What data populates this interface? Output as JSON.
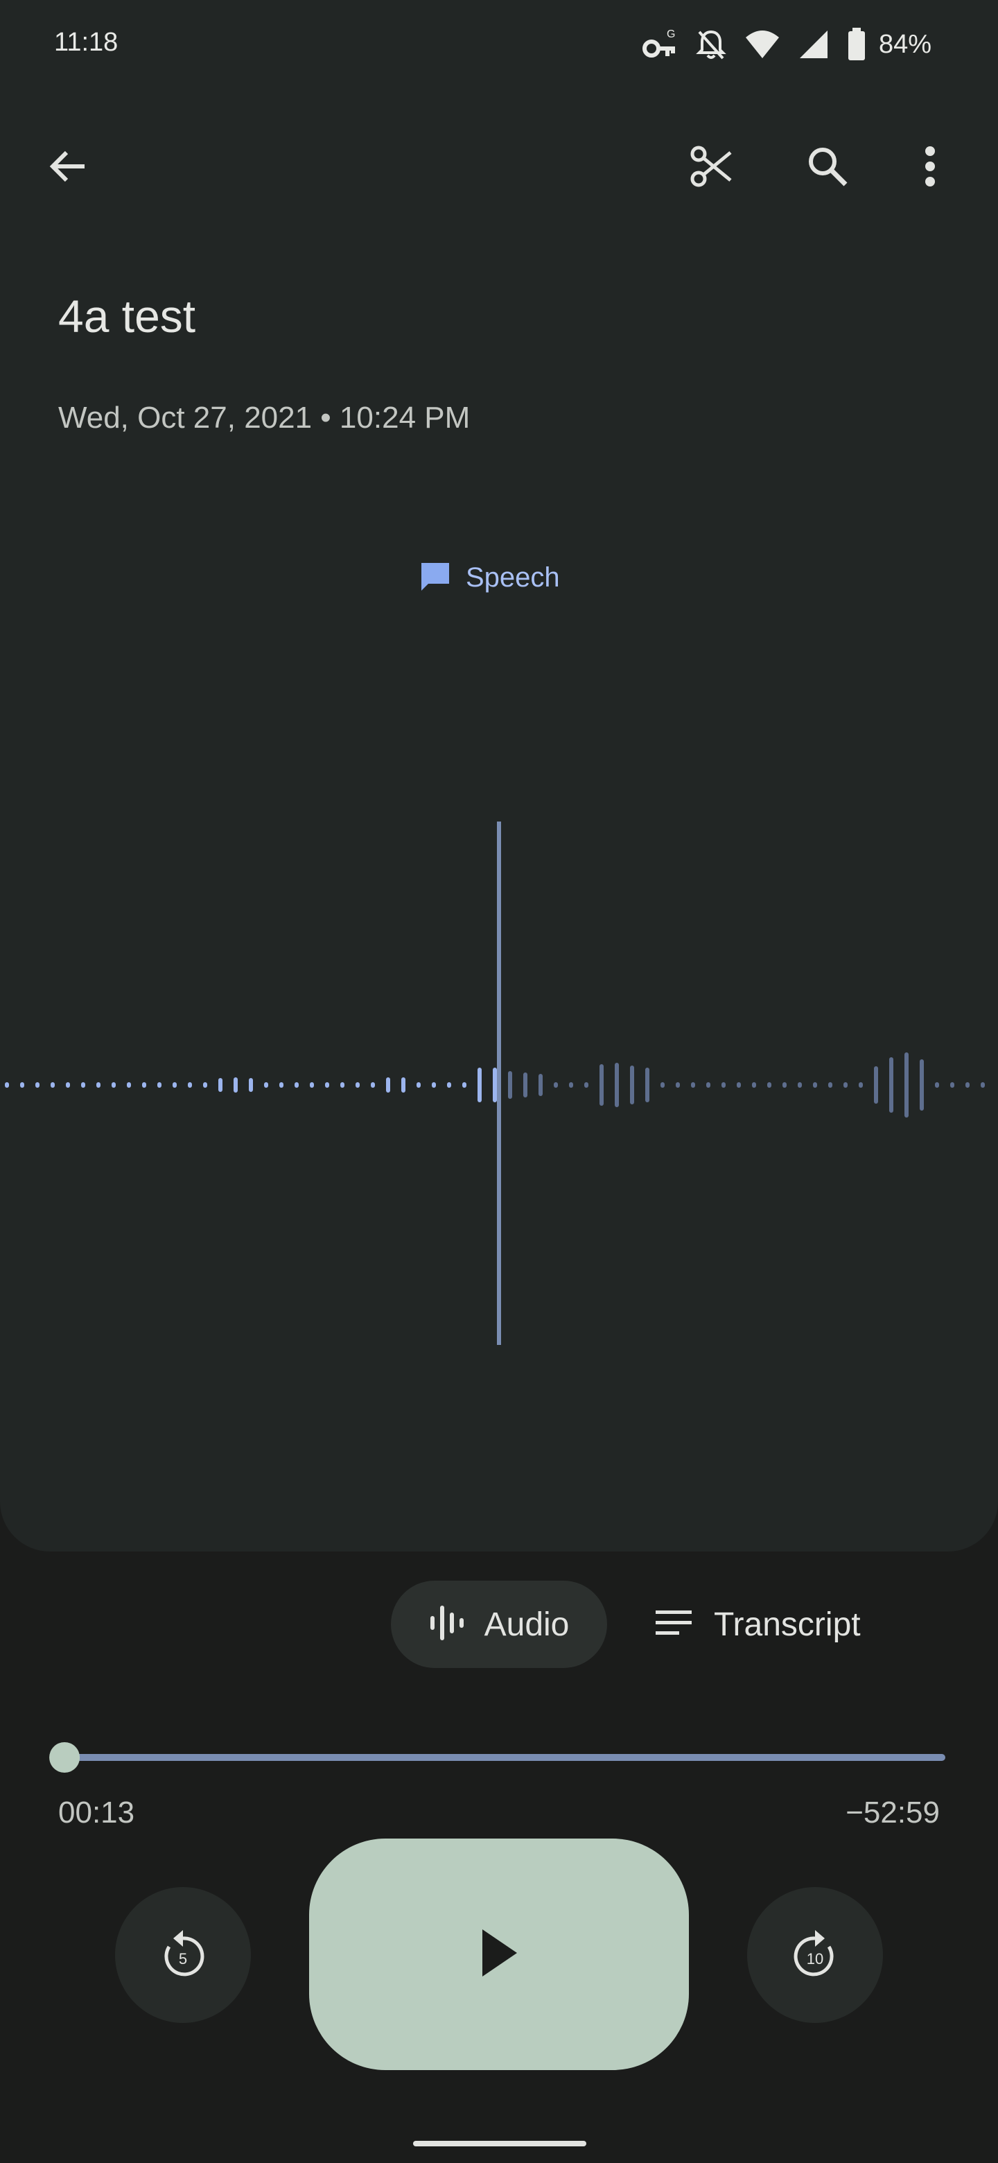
{
  "status_bar": {
    "time": "11:18",
    "battery_percent": "84%",
    "icons": [
      "vpn-key-icon",
      "notifications-off-icon",
      "wifi-icon",
      "cell-signal-icon",
      "battery-icon"
    ]
  },
  "toolbar": {
    "back_icon": "arrow-back-icon",
    "trim_icon": "scissors-icon",
    "search_icon": "search-icon",
    "more_icon": "more-vert-icon"
  },
  "recording": {
    "title": "4a test",
    "datetime": "Wed, Oct 27, 2021 • 10:24 PM"
  },
  "speech_chip": {
    "label": "Speech",
    "icon": "speech-bubble-icon"
  },
  "view_toggle": {
    "audio_label": "Audio",
    "transcript_label": "Transcript",
    "selected": "Audio"
  },
  "playback": {
    "elapsed": "00:13",
    "remaining": "−52:59",
    "progress_fraction": 0.004,
    "rewind_seconds": "5",
    "forward_seconds": "10"
  },
  "colors": {
    "background": "#1b1c1b",
    "panel": "#222625",
    "accent_blue": "#a9c0f5",
    "wave_played": "#9cb5ee",
    "wave_unplayed": "#5e6e8e",
    "play_button": "#b9cdbf"
  }
}
